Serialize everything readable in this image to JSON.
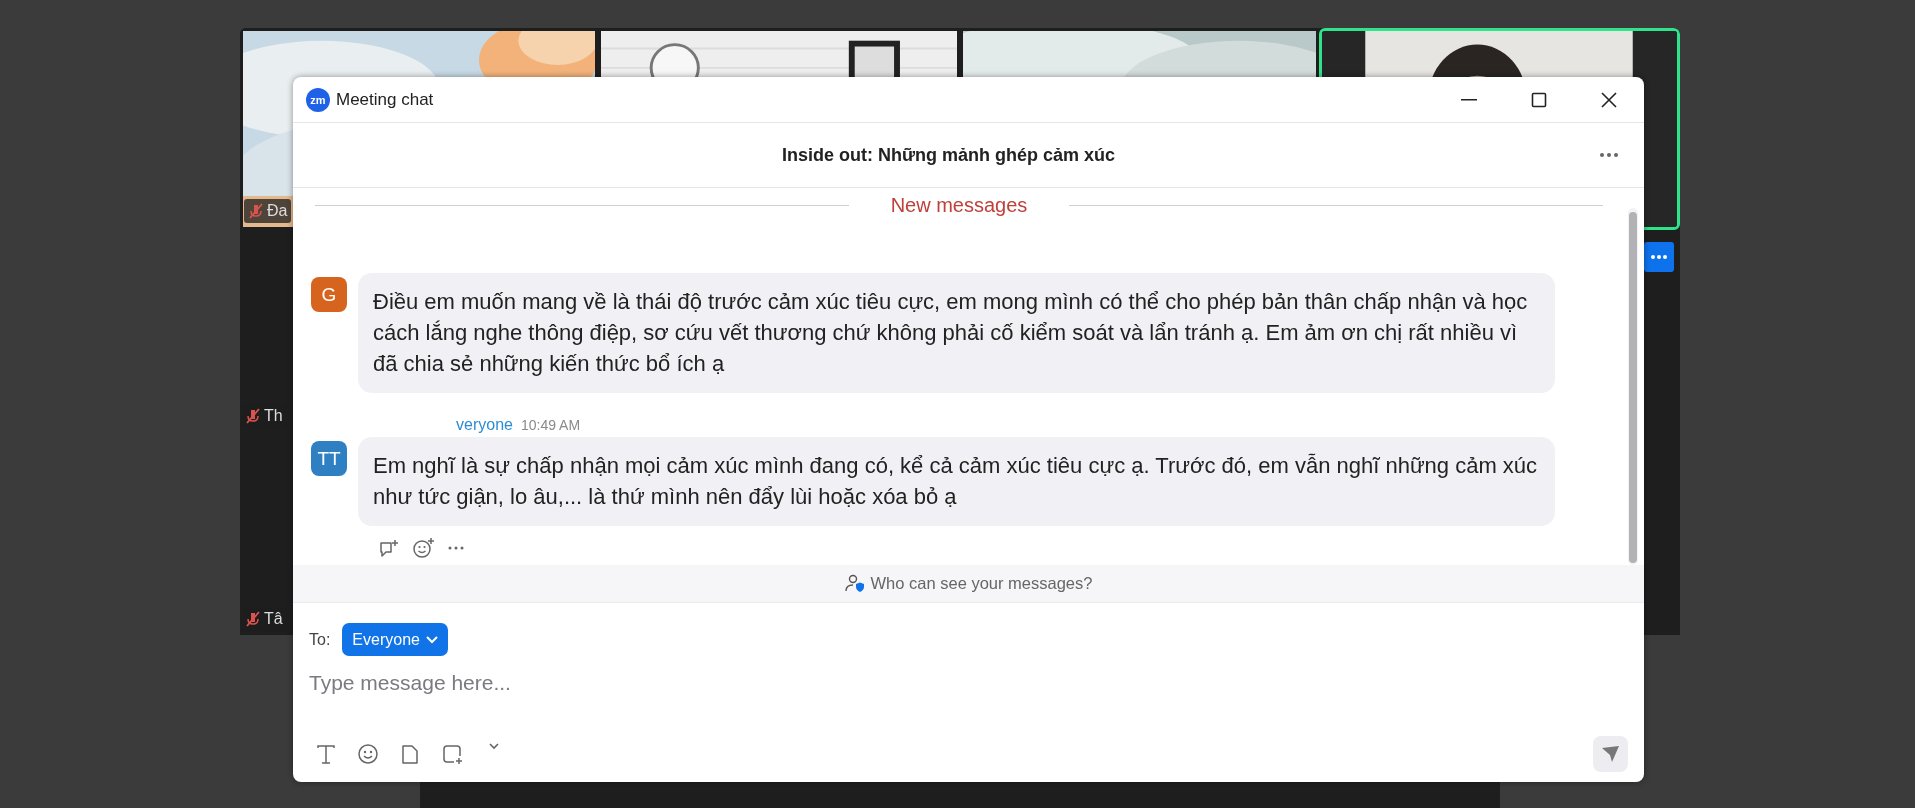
{
  "gallery": {
    "tiles": [
      {
        "kind": "sky",
        "active": false,
        "name": "Đa",
        "muted": true
      },
      {
        "kind": "wall",
        "active": false
      },
      {
        "kind": "clouds",
        "active": false
      },
      {
        "kind": "room",
        "active": true
      },
      {
        "kind": "dark",
        "active": false,
        "name": "Th",
        "muted": true
      },
      {
        "kind": "dark",
        "active": false,
        "name": "Tâ",
        "muted": true
      }
    ]
  },
  "chat_window": {
    "app_icon": "zm",
    "title": "Meeting chat",
    "header": {
      "title": "Inside out: Những mảnh ghép cảm xúc"
    },
    "new_messages_label": "New messages",
    "messages": [
      {
        "avatar": "G",
        "color": "#d6641f",
        "text": "Điều em muốn mang về là thái độ trước cảm xúc tiêu cực, em mong mình có thể cho phép bản thân chấp nhận và học cách lắng nghe thông điệp, sơ cứu vết thương chứ không phải cố kiểm soát và lẩn tránh ạ. Em ảm ơn chị rất nhiều vì đã chia sẻ những kiến thức bổ ích ạ"
      },
      {
        "avatar": "TT",
        "color": "#2f80c2",
        "sender": "veryone",
        "time": "10:49 AM",
        "text": "Em nghĩ là sự chấp nhận mọi cảm xúc mình đang có, kể cả cảm xúc tiêu cực ạ. Trước đó, em vẫn nghĩ những cảm xúc như tức giận, lo âu,... là thứ mình nên đẩy lùi hoặc xóa bỏ ạ"
      }
    ],
    "privacy_note": "Who can see your messages?",
    "composer": {
      "to_label": "To:",
      "recipient": "Everyone",
      "placeholder": "Type message here..."
    }
  }
}
